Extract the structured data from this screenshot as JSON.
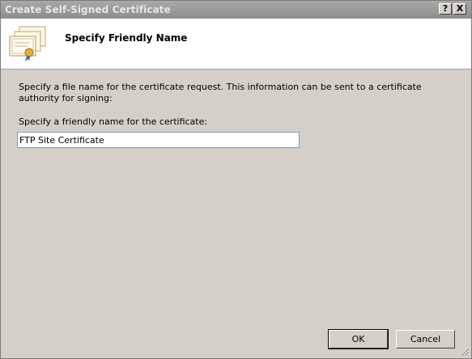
{
  "window": {
    "title": "Create Self-Signed Certificate",
    "help_glyph": "?",
    "close_glyph": "X"
  },
  "header": {
    "heading": "Specify Friendly Name",
    "icon": "certificate-icon"
  },
  "body": {
    "description": "Specify a file name for the certificate request.  This information can be sent to a certificate authority for signing:",
    "field_label": "Specify a friendly name for the certificate:",
    "field_value": "FTP Site Certificate"
  },
  "buttons": {
    "ok_label": "OK",
    "cancel_label": "Cancel"
  },
  "colors": {
    "titlebar": "#8c8c8c",
    "dialog_bg": "#d4d0c8",
    "header_bg": "#ffffff"
  }
}
